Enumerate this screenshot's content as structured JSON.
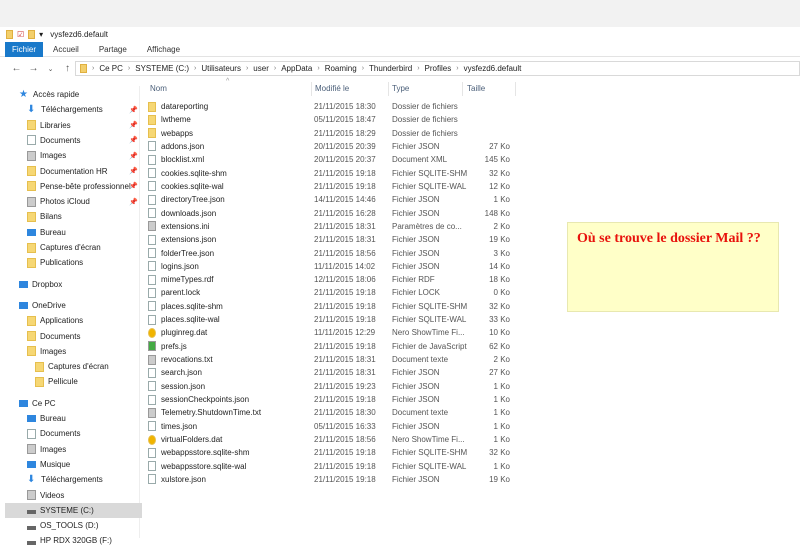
{
  "window": {
    "title": "vysfezd6.default"
  },
  "ribbon": {
    "tabs": [
      "Fichier",
      "Accueil",
      "Partage",
      "Affichage"
    ]
  },
  "address": {
    "crumbs": [
      "Ce PC",
      "SYSTEME (C:)",
      "Utilisateurs",
      "user",
      "AppData",
      "Roaming",
      "Thunderbird",
      "Profiles",
      "vysfezd6.default"
    ]
  },
  "sidebar": {
    "items": [
      {
        "label": "Accès rapide",
        "icon": "star",
        "indent": 0,
        "pinned": false
      },
      {
        "label": "Téléchargements",
        "icon": "download",
        "indent": 1,
        "pinned": true
      },
      {
        "label": "Libraries",
        "icon": "folder",
        "indent": 1,
        "pinned": true
      },
      {
        "label": "Documents",
        "icon": "doc",
        "indent": 1,
        "pinned": true
      },
      {
        "label": "Images",
        "icon": "gray",
        "indent": 1,
        "pinned": true
      },
      {
        "label": "Documentation HR",
        "icon": "folder",
        "indent": 1,
        "pinned": true
      },
      {
        "label": "Pense-bête professionnel",
        "icon": "folder",
        "indent": 1,
        "pinned": true
      },
      {
        "label": "Photos iCloud",
        "icon": "gray",
        "indent": 1,
        "pinned": true
      },
      {
        "label": "Bilans",
        "icon": "folder",
        "indent": 1,
        "pinned": false
      },
      {
        "label": "Bureau",
        "icon": "blue",
        "indent": 1,
        "pinned": false
      },
      {
        "label": "Captures d'écran",
        "icon": "folder",
        "indent": 1,
        "pinned": false
      },
      {
        "label": "Publications",
        "icon": "folder",
        "indent": 1,
        "pinned": false
      },
      {
        "label": "Dropbox",
        "icon": "blue",
        "indent": 0,
        "pinned": false,
        "gap": true
      },
      {
        "label": "OneDrive",
        "icon": "blue",
        "indent": 0,
        "pinned": false,
        "gap": true
      },
      {
        "label": "Applications",
        "icon": "folder",
        "indent": 1,
        "pinned": false
      },
      {
        "label": "Documents",
        "icon": "folder",
        "indent": 1,
        "pinned": false
      },
      {
        "label": "Images",
        "icon": "folder",
        "indent": 1,
        "pinned": false
      },
      {
        "label": "Captures d'écran",
        "icon": "folder",
        "indent": 2,
        "pinned": false
      },
      {
        "label": "Pellicule",
        "icon": "folder",
        "indent": 2,
        "pinned": false
      },
      {
        "label": "Ce PC",
        "icon": "blue",
        "indent": 0,
        "pinned": false,
        "gap": true
      },
      {
        "label": "Bureau",
        "icon": "blue",
        "indent": 1,
        "pinned": false
      },
      {
        "label": "Documents",
        "icon": "doc",
        "indent": 1,
        "pinned": false
      },
      {
        "label": "Images",
        "icon": "gray",
        "indent": 1,
        "pinned": false
      },
      {
        "label": "Musique",
        "icon": "blue",
        "indent": 1,
        "pinned": false
      },
      {
        "label": "Téléchargements",
        "icon": "download",
        "indent": 1,
        "pinned": false
      },
      {
        "label": "Videos",
        "icon": "gray",
        "indent": 1,
        "pinned": false
      },
      {
        "label": "SYSTEME (C:)",
        "icon": "drive",
        "indent": 1,
        "pinned": false,
        "selected": true
      },
      {
        "label": "OS_TOOLS (D:)",
        "icon": "drive",
        "indent": 1,
        "pinned": false
      },
      {
        "label": "HP RDX 320GB (F:)",
        "icon": "drive",
        "indent": 1,
        "pinned": false
      }
    ]
  },
  "columns": {
    "name": "Nom",
    "modified": "Modifié le",
    "type": "Type",
    "size": "Taille"
  },
  "files": [
    [
      "datareporting",
      "21/11/2015 18:30",
      "Dossier de fichiers",
      "",
      "folder"
    ],
    [
      "lwtheme",
      "05/11/2015 18:47",
      "Dossier de fichiers",
      "",
      "folder"
    ],
    [
      "webapps",
      "21/11/2015 18:29",
      "Dossier de fichiers",
      "",
      "folder"
    ],
    [
      "addons.json",
      "20/11/2015 20:39",
      "Fichier JSON",
      "27 Ko",
      "doc"
    ],
    [
      "blocklist.xml",
      "20/11/2015 20:37",
      "Document XML",
      "145 Ko",
      "doc"
    ],
    [
      "cookies.sqlite-shm",
      "21/11/2015 19:18",
      "Fichier SQLITE-SHM",
      "32 Ko",
      "doc"
    ],
    [
      "cookies.sqlite-wal",
      "21/11/2015 19:18",
      "Fichier SQLITE-WAL",
      "12 Ko",
      "doc"
    ],
    [
      "directoryTree.json",
      "14/11/2015 14:46",
      "Fichier JSON",
      "1 Ko",
      "doc"
    ],
    [
      "downloads.json",
      "21/11/2015 16:28",
      "Fichier JSON",
      "148 Ko",
      "doc"
    ],
    [
      "extensions.ini",
      "21/11/2015 18:31",
      "Paramètres de co...",
      "2 Ko",
      "gray"
    ],
    [
      "extensions.json",
      "21/11/2015 18:31",
      "Fichier JSON",
      "19 Ko",
      "doc"
    ],
    [
      "folderTree.json",
      "21/11/2015 18:56",
      "Fichier JSON",
      "3 Ko",
      "doc"
    ],
    [
      "logins.json",
      "11/11/2015 14:02",
      "Fichier JSON",
      "14 Ko",
      "doc"
    ],
    [
      "mimeTypes.rdf",
      "12/11/2015 18:06",
      "Fichier RDF",
      "18 Ko",
      "doc"
    ],
    [
      "parent.lock",
      "21/11/2015 19:18",
      "Fichier LOCK",
      "0 Ko",
      "doc"
    ],
    [
      "places.sqlite-shm",
      "21/11/2015 19:18",
      "Fichier SQLITE-SHM",
      "32 Ko",
      "doc"
    ],
    [
      "places.sqlite-wal",
      "21/11/2015 19:18",
      "Fichier SQLITE-WAL",
      "33 Ko",
      "doc"
    ],
    [
      "pluginreg.dat",
      "11/11/2015 12:29",
      "Nero ShowTime Fi...",
      "10 Ko",
      "nero"
    ],
    [
      "prefs.js",
      "21/11/2015 19:18",
      "Fichier de JavaScript",
      "62 Ko",
      "js"
    ],
    [
      "revocations.txt",
      "21/11/2015 18:31",
      "Document texte",
      "2 Ko",
      "gray"
    ],
    [
      "search.json",
      "21/11/2015 18:31",
      "Fichier JSON",
      "27 Ko",
      "doc"
    ],
    [
      "session.json",
      "21/11/2015 19:23",
      "Fichier JSON",
      "1 Ko",
      "doc"
    ],
    [
      "sessionCheckpoints.json",
      "21/11/2015 19:18",
      "Fichier JSON",
      "1 Ko",
      "doc"
    ],
    [
      "Telemetry.ShutdownTime.txt",
      "21/11/2015 18:30",
      "Document texte",
      "1 Ko",
      "gray"
    ],
    [
      "times.json",
      "05/11/2015 16:33",
      "Fichier JSON",
      "1 Ko",
      "doc"
    ],
    [
      "virtualFolders.dat",
      "21/11/2015 18:56",
      "Nero ShowTime Fi...",
      "1 Ko",
      "nero"
    ],
    [
      "webappsstore.sqlite-shm",
      "21/11/2015 19:18",
      "Fichier SQLITE-SHM",
      "32 Ko",
      "doc"
    ],
    [
      "webappsstore.sqlite-wal",
      "21/11/2015 19:18",
      "Fichier SQLITE-WAL",
      "1 Ko",
      "doc"
    ],
    [
      "xulstore.json",
      "21/11/2015 19:18",
      "Fichier JSON",
      "19 Ko",
      "doc"
    ]
  ],
  "note": {
    "text": "Où se trouve le dossier Mail ??"
  }
}
